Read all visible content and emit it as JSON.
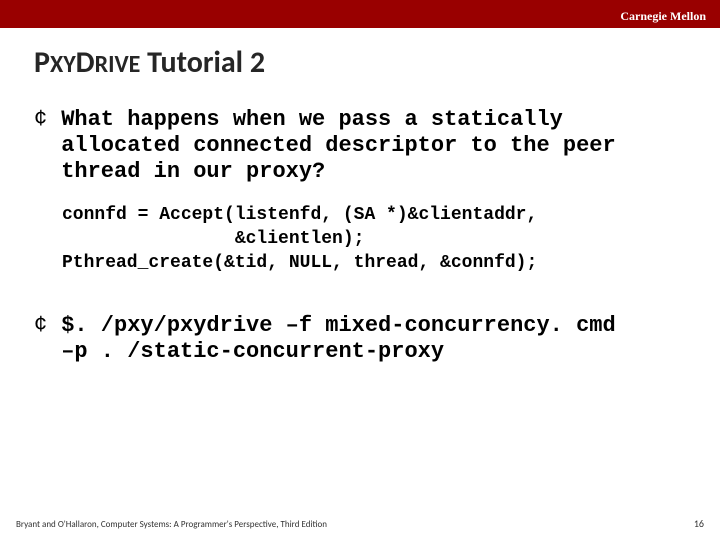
{
  "header": {
    "org": "Carnegie Mellon"
  },
  "title": {
    "part1a": "P",
    "part1b": "XY",
    "part2a": "D",
    "part2b": "RIVE",
    "rest": " Tutorial 2"
  },
  "bullets": {
    "marker": "¢",
    "q_text": "What happens when we pass a statically allocated connected descriptor to the peer thread in our proxy?",
    "code": "connfd = Accept(listenfd, (SA *)&clientaddr,\n                &clientlen);\nPthread_create(&tid, NULL, thread, &connfd);",
    "cmd_line1": "$. /pxy/pxydrive –f mixed-concurrency. cmd",
    "cmd_line2": "–p . /static-concurrent-proxy"
  },
  "footer": {
    "left": "Bryant and O'Hallaron, Computer Systems: A Programmer's Perspective, Third Edition",
    "page": "16"
  }
}
